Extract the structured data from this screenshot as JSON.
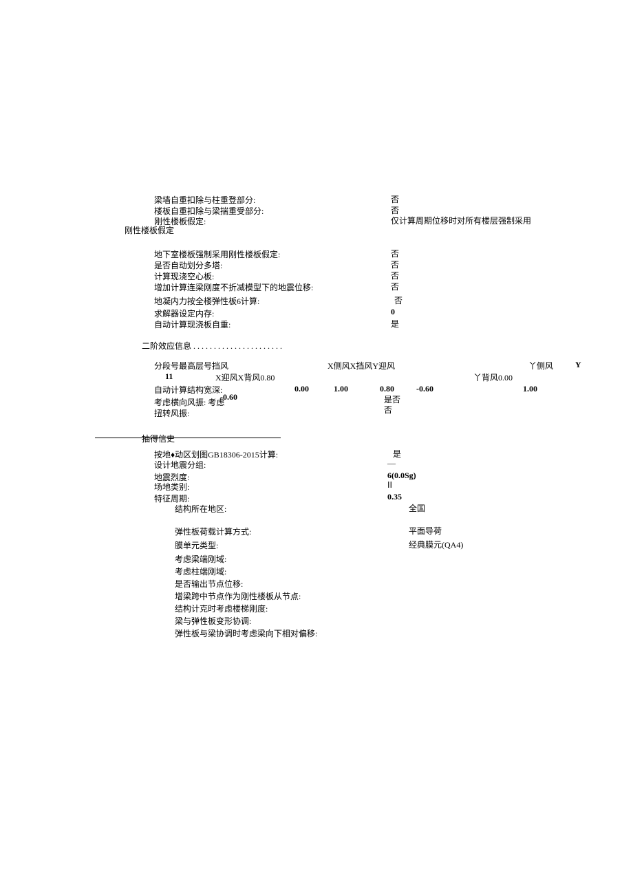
{
  "section1": {
    "beam_wall_self_deduct": {
      "label": "梁墙自重扣除与柱重登部分:",
      "value": "否"
    },
    "slab_self_deduct": {
      "label": "楼板自重扣除与梁揣重受部分:",
      "value": "否"
    },
    "rigid_floor_assume": {
      "label": "刚性楼板假定:",
      "value": "仅计算周期位移时对所有楼层强制采用"
    },
    "rigid_floor_assume_cont": "刚性楼板假定",
    "basement_rigid": {
      "label": "地下室楼板强制采用刚性楼板假定:",
      "value": "否"
    },
    "auto_multi_tower": {
      "label": "是否自动划分多塔:",
      "value": "否"
    },
    "cast_hollow_slab": {
      "label": "计算现浇空心板:",
      "value": "否"
    },
    "add_conn_beam_disp": {
      "label": "增加计算连梁刚度不折减模型下的地震位移:",
      "value": "否"
    },
    "geo_force_elastic6": {
      "label": "地凝内力按全楼弹性板6计算:",
      "value": "否"
    },
    "solver_mem": {
      "label": "求解器设定内存:",
      "value": "0"
    },
    "auto_castslab_weight": {
      "label": "自动计算现浇板自重:",
      "value": "是"
    }
  },
  "second_order": {
    "title": "二阶效应信息  . . . . . . . . . . . . . . . . . . . . . ."
  },
  "wind_segment": {
    "headers": {
      "seg_top": "分段号最高层号挡风",
      "x_windward_back": "X迎风X背风0.80",
      "x_side_block_y_wind": "X侧风X挡风Y迎风",
      "y_back": "丫背风0.00",
      "y_side": "丫侧风",
      "y_bold": "Y"
    },
    "row": {
      "seg": "11",
      "v2": "0.00",
      "v3": "1.00",
      "v4": "0.80",
      "v5": "-0.60",
      "v7": "1.00"
    },
    "auto_width_label": "自动计算结构宽深:",
    "neg06": "-0.60",
    "shifou_a": "是否",
    "shifou_b": "否",
    "lateral_label": "考虑横向风振:  考虑",
    "torsion_label": "扭转风振:"
  },
  "seismic": {
    "header": "抽得信史",
    "gb_calc": {
      "label": "按地♦动区划图GB18306-2015计算:",
      "value": "是"
    },
    "design_group": {
      "label": "设计地震分组:",
      "value": "—"
    },
    "intensity": {
      "label": "地震烈度:",
      "value": "6(0.0Sg)"
    },
    "site_class": {
      "label": "场地类别:",
      "value": "ⅠⅠ"
    },
    "char_period": {
      "label": "特征周期:",
      "value": "0.35"
    },
    "region": {
      "label": "结构所在地区:",
      "value": "全国"
    }
  },
  "bottom": {
    "elastic_load": {
      "label": "弹性板荷载计算方式:",
      "value": "平面导荷"
    },
    "membrane": {
      "label": "膜单元类型:",
      "value": "经典膜元(QA4)"
    },
    "beam_end_rigid": {
      "label": "考虑梁端刚域:"
    },
    "col_end_rigid": {
      "label": "考虑柱端刚域:"
    },
    "output_node_disp": {
      "label": "是否输出节点位移:"
    },
    "add_mid_node": {
      "label": "增梁跨中节点作为刚性楼板从节点:"
    },
    "stair_stiff": {
      "label": "结构计克时考虑楼梯刚度:"
    },
    "beam_elastic_compat": {
      "label": "梁与弹性板变形协调:"
    },
    "rel_offset": {
      "label": "弹性板与梁协调时考虑梁向下相对偏移:"
    }
  }
}
